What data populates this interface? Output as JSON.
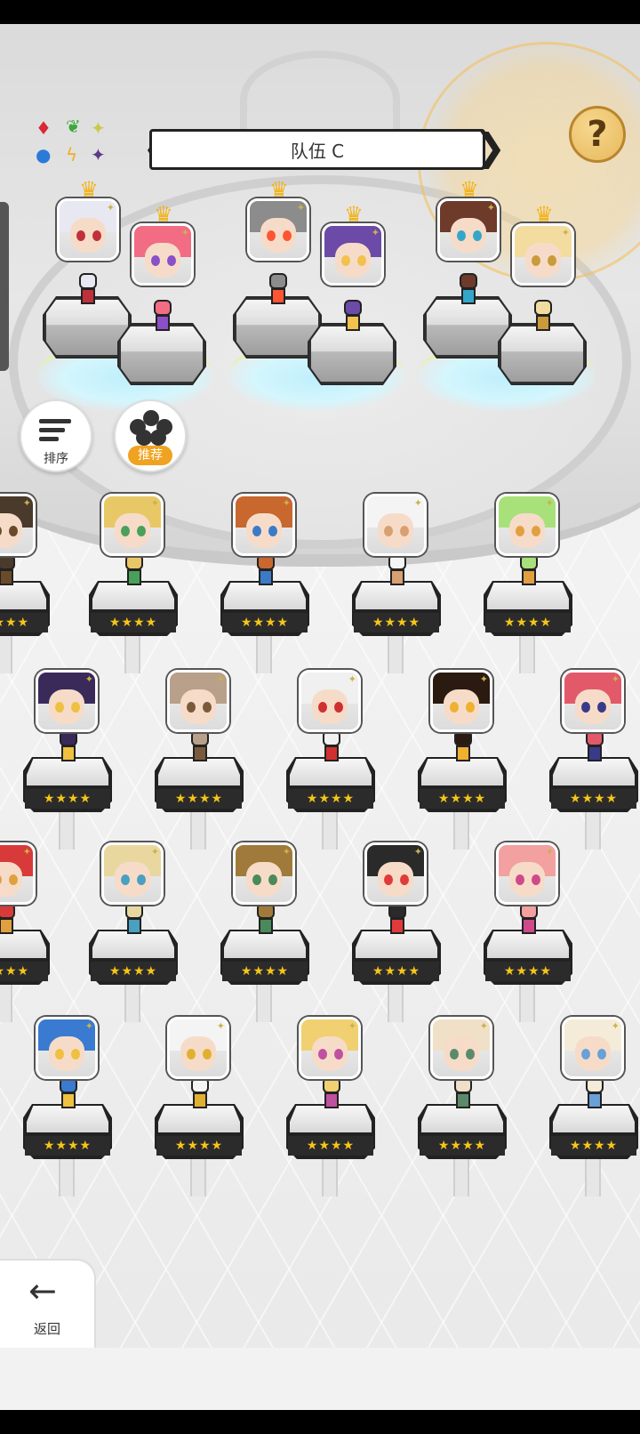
{
  "header": {
    "team_name": "队伍 C",
    "prev_arrow": "❮",
    "next_arrow": "❯",
    "help_label": "?"
  },
  "buttons": {
    "sort_label": "排序",
    "recommend_label": "推荐",
    "back_label": "返回",
    "back_arrow": "←"
  },
  "element_icons": [
    "fire-gem-icon",
    "leaf-icon",
    "light-sparkle-icon",
    "water-orb-icon",
    "lightning-icon",
    "dark-star-icon"
  ],
  "star_rating": "★★★★",
  "colors": {
    "accent_orange": "#f0a320",
    "crown_gold": "#f2b319",
    "help_gold": "#e8b85a",
    "slot_glow": "#bfeffc",
    "star_color": "#f5c518"
  },
  "team_slots": [
    {
      "slot": 1,
      "heroes": [
        {
          "hair": "#e8e8f2",
          "eye": "#c0303a"
        },
        {
          "hair": "#f26c84",
          "eye": "#8b4fc9"
        }
      ]
    },
    {
      "slot": 2,
      "heroes": [
        {
          "hair": "#8c8c8c",
          "eye": "#ff5533"
        },
        {
          "hair": "#6b4aa8",
          "eye": "#f2c14e"
        }
      ]
    },
    {
      "slot": 3,
      "heroes": [
        {
          "hair": "#6e3a2a",
          "eye": "#34a7c9"
        },
        {
          "hair": "#f3dca0",
          "eye": "#c99b3a"
        }
      ]
    }
  ],
  "roster_rows": [
    [
      {
        "hair": "#4a3a2c",
        "eye": "#6b4a2a",
        "partial": "left"
      },
      {
        "hair": "#e8c766",
        "eye": "#4a9f5a"
      },
      {
        "hair": "#c8672e",
        "eye": "#3a7ac9"
      },
      {
        "hair": "#f4f4f4",
        "eye": "#d8a070"
      },
      {
        "hair": "#a8e07a",
        "eye": "#e0a040"
      }
    ],
    [
      {
        "hair": "#3a2a5a",
        "eye": "#f0c040"
      },
      {
        "hair": "#b8a08a",
        "eye": "#7a5a3a"
      },
      {
        "hair": "#f0f0f0",
        "eye": "#d03030"
      },
      {
        "hair": "#2a1a10",
        "eye": "#f0b030"
      },
      {
        "hair": "#e25a6a",
        "eye": "#3a3a8a"
      }
    ],
    [
      {
        "hair": "#d83a3a",
        "eye": "#e0a040",
        "partial": "left"
      },
      {
        "hair": "#e8d8a0",
        "eye": "#4aa0c0"
      },
      {
        "hair": "#a07a3a",
        "eye": "#4a8a5a"
      },
      {
        "hair": "#2a2a2a",
        "eye": "#e03a3a"
      },
      {
        "hair": "#f2a0a0",
        "eye": "#d04a8a"
      }
    ],
    [
      {
        "hair": "#3a7ad0",
        "eye": "#f0c040"
      },
      {
        "hair": "#f4f4f4",
        "eye": "#e0b030"
      },
      {
        "hair": "#f0d070",
        "eye": "#c050a0"
      },
      {
        "hair": "#f0e0c8",
        "eye": "#5a8a6a"
      },
      {
        "hair": "#f4ecd8",
        "eye": "#6aa0d8"
      }
    ]
  ]
}
